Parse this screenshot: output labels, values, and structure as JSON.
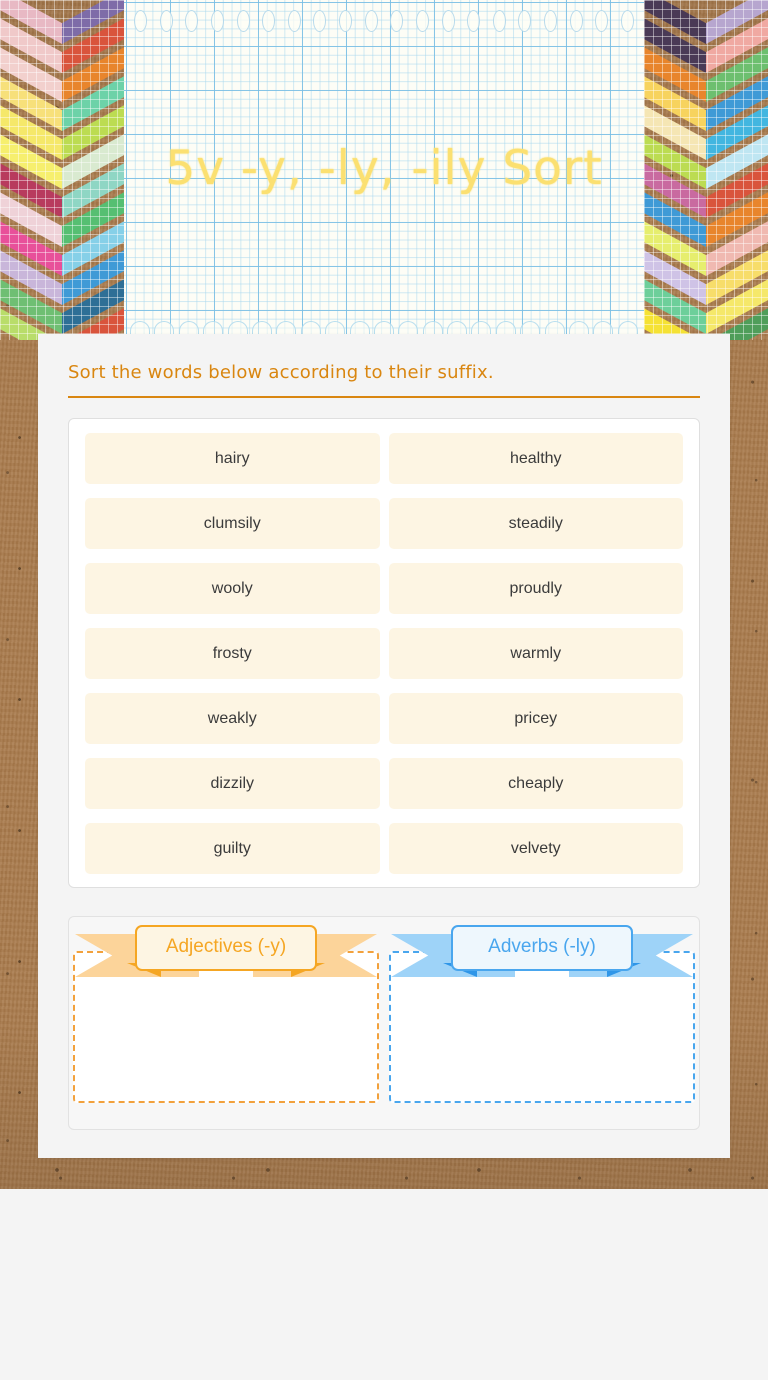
{
  "header": {
    "title": "5v -y, -ly, -ily Sort",
    "title_color": "#fbe071",
    "paper_style": "graph-paper"
  },
  "activity": {
    "instruction": "Sort the words below according to their suffix.",
    "instruction_color": "#d98610"
  },
  "word_bank": {
    "words": [
      "hairy",
      "healthy",
      "clumsily",
      "steadily",
      "wooly",
      "proudly",
      "frosty",
      "warmly",
      "weakly",
      "pricey",
      "dizzily",
      "cheaply",
      "guilty",
      "velvety"
    ],
    "tile_color": "#fdf5e3"
  },
  "drop_zones": [
    {
      "label": "Adjectives (-y)",
      "accent": "#f5a623",
      "tail_color": "#fcd49a",
      "items": []
    },
    {
      "label": "Adverbs (-ly)",
      "accent": "#49a6ee",
      "tail_color": "#9ed3f8",
      "items": []
    }
  ],
  "chevron_palette": {
    "left": [
      [
        "#e8b9c4",
        "#7e6ca8"
      ],
      [
        "#f0c9c9",
        "#d9543c"
      ],
      [
        "#f2d0cd",
        "#e8852c"
      ],
      [
        "#f7e07a",
        "#6dd2a8"
      ],
      [
        "#f5e86a",
        "#bcdc52"
      ],
      [
        "#f6ef6e",
        "#d9ead0"
      ],
      [
        "#b83b5e",
        "#8fd6c4"
      ],
      [
        "#efd2d8",
        "#56bf72"
      ],
      [
        "#e8509a",
        "#86d0e8"
      ],
      [
        "#c9b6da",
        "#3f9ad6"
      ],
      [
        "#6fbf73",
        "#2e6f96"
      ],
      [
        "#b9dd6a",
        "#d9543c"
      ]
    ],
    "right": [
      [
        "#4a3a56",
        "#b7a6cf"
      ],
      [
        "#4a3a56",
        "#f0a9a2"
      ],
      [
        "#e8852c",
        "#6dbf6f"
      ],
      [
        "#f7d35e",
        "#3f9ad6"
      ],
      [
        "#f5e6b4",
        "#42b6e0"
      ],
      [
        "#bcdc52",
        "#bfe6f2"
      ],
      [
        "#c96aa0",
        "#d9543c"
      ],
      [
        "#3f9ad6",
        "#e8852c"
      ],
      [
        "#e6ee6e",
        "#f0b9b1"
      ],
      [
        "#cfc3e6",
        "#f7dd6a"
      ],
      [
        "#6dcf9a",
        "#f5e86a"
      ],
      [
        "#f5e234",
        "#4f9e5a"
      ]
    ]
  }
}
